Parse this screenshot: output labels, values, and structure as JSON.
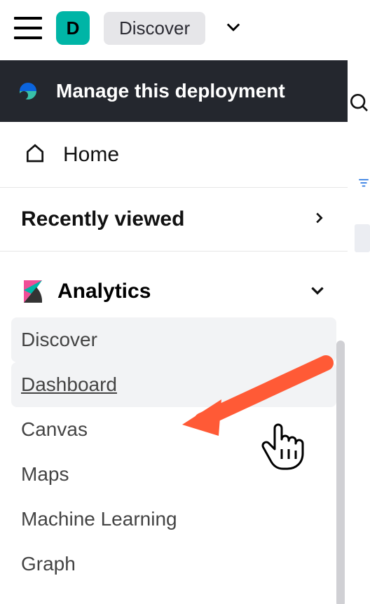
{
  "topbar": {
    "space_letter": "D",
    "breadcrumb": "Discover"
  },
  "deploy": {
    "label": "Manage this deployment"
  },
  "home": {
    "label": "Home"
  },
  "recent": {
    "label": "Recently viewed"
  },
  "analytics": {
    "title": "Analytics",
    "items": [
      {
        "label": "Discover"
      },
      {
        "label": "Dashboard"
      },
      {
        "label": "Canvas"
      },
      {
        "label": "Maps"
      },
      {
        "label": "Machine Learning"
      },
      {
        "label": "Graph"
      }
    ]
  }
}
